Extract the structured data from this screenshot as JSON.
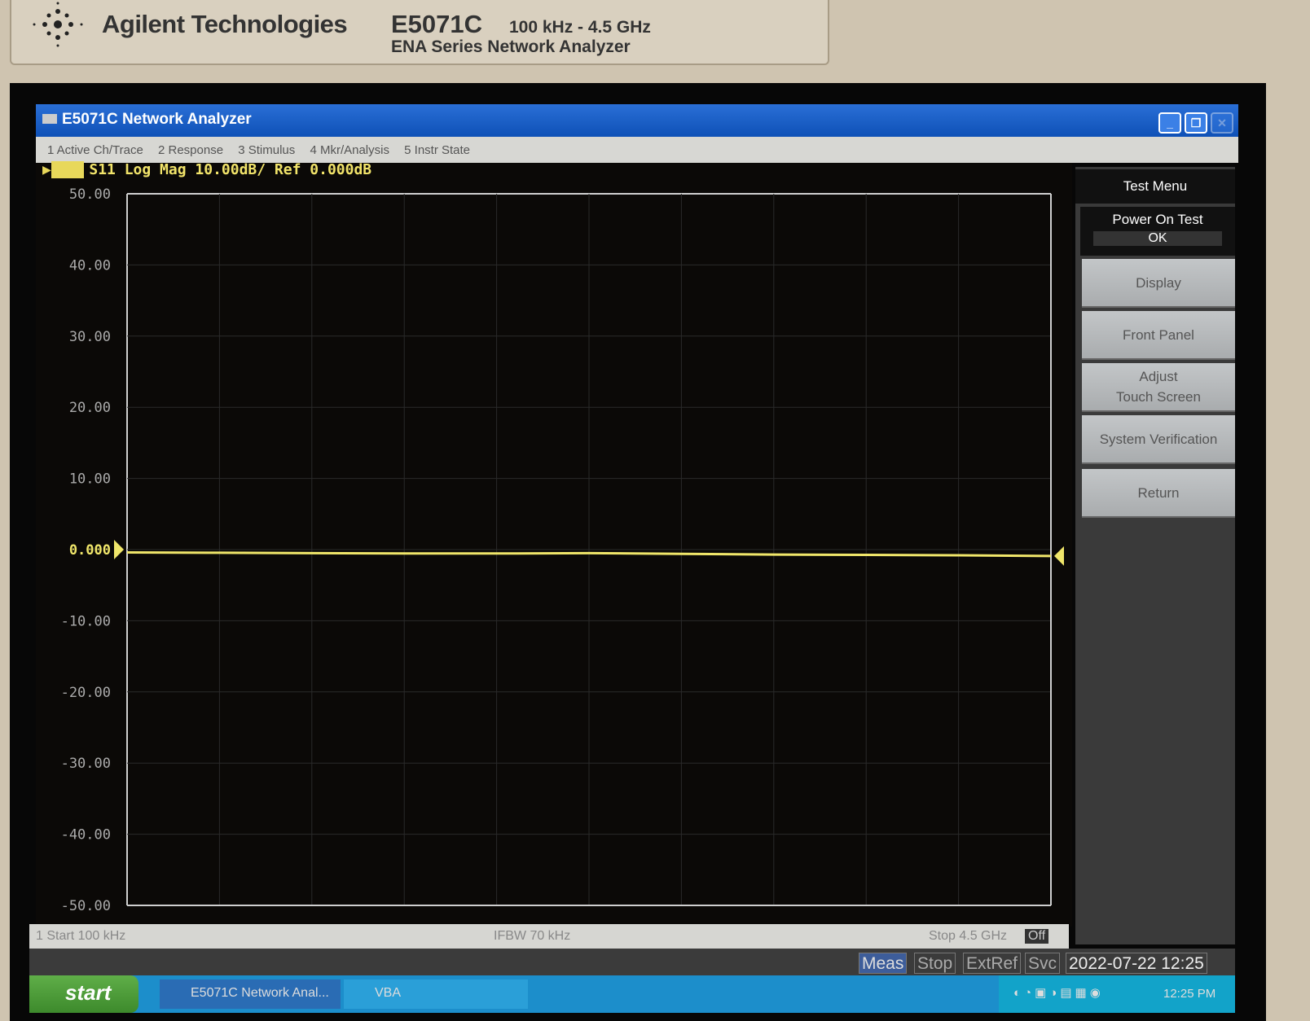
{
  "device": {
    "brand": "Agilent Technologies",
    "model": "E5071C",
    "range": "100 kHz - 4.5 GHz",
    "series": "ENA Series  Network Analyzer"
  },
  "window": {
    "title": "E5071C Network Analyzer",
    "buttons": [
      "minimize",
      "restore",
      "close"
    ]
  },
  "menu": [
    "1 Active Ch/Trace",
    "2 Response",
    "3 Stimulus",
    "4 Mkr/Analysis",
    "5 Instr State"
  ],
  "trace": {
    "id": "Tr1",
    "label": "S11 Log Mag 10.00dB/ Ref 0.000dB",
    "color": "#f0e66a"
  },
  "chart_data": {
    "type": "line",
    "ylabels": [
      "50.00",
      "40.00",
      "30.00",
      "20.00",
      "10.00",
      "0.000",
      "-10.00",
      "-20.00",
      "-30.00",
      "-40.00",
      "-50.00"
    ],
    "ylim": [
      -50,
      50
    ],
    "xlim_ghz": [
      0.0001,
      4.5
    ],
    "grid": true,
    "series": [
      {
        "x": [
          0.0001,
          0.45,
          0.9,
          1.35,
          1.8,
          2.25,
          2.7,
          3.15,
          3.6,
          4.05,
          4.5
        ],
        "y": [
          -0.4,
          -0.45,
          -0.5,
          -0.55,
          -0.55,
          -0.5,
          -0.6,
          -0.7,
          -0.75,
          -0.8,
          -0.9
        ]
      }
    ],
    "reference": 0
  },
  "softkeys": {
    "title": "Test Menu",
    "power_on_test": "Power On Test",
    "power_on_status": "OK",
    "items": [
      "Display",
      "Front Panel",
      "Adjust\nTouch Screen",
      "System Verification",
      "Return"
    ]
  },
  "status": {
    "start": "1  Start 100 kHz",
    "ifbw": "IFBW 70 kHz",
    "stop": "Stop 4.5 GHz",
    "off": "Off"
  },
  "statline": {
    "meas": "Meas",
    "stop": "Stop",
    "extref": "ExtRef",
    "svc": "Svc",
    "datetime": "2022-07-22 12:25"
  },
  "taskbar": {
    "start": "start",
    "tasks": [
      "E5071C Network Anal...",
      "VBA"
    ],
    "clock": "12:25 PM"
  }
}
